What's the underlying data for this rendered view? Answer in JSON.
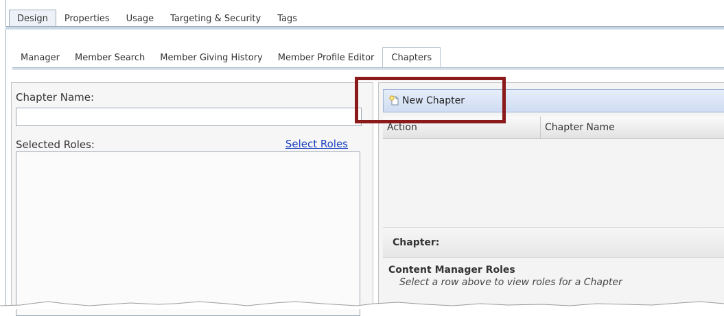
{
  "top_tabs": [
    "Design",
    "Properties",
    "Usage",
    "Targeting & Security",
    "Tags"
  ],
  "sub_tabs": [
    "Manager",
    "Member Search",
    "Member Giving History",
    "Member Profile Editor",
    "Chapters"
  ],
  "left": {
    "chapter_name_label": "Chapter Name:",
    "chapter_name_value": "",
    "selected_roles_label": "Selected Roles:",
    "select_roles_link": "Select Roles"
  },
  "right": {
    "new_chapter_label": "New Chapter",
    "grid_columns": [
      "Action",
      "Chapter Name"
    ],
    "chapter_section_label": "Chapter:",
    "content_manager_title": "Content Manager Roles",
    "content_manager_hint": "Select a row above to view roles for a Chapter"
  },
  "colors": {
    "highlight_border": "#8b1a1a",
    "link": "#1a3fbf",
    "toolbar": "#cfdcf2"
  },
  "icons": {
    "new_chapter": "new-page-icon"
  }
}
